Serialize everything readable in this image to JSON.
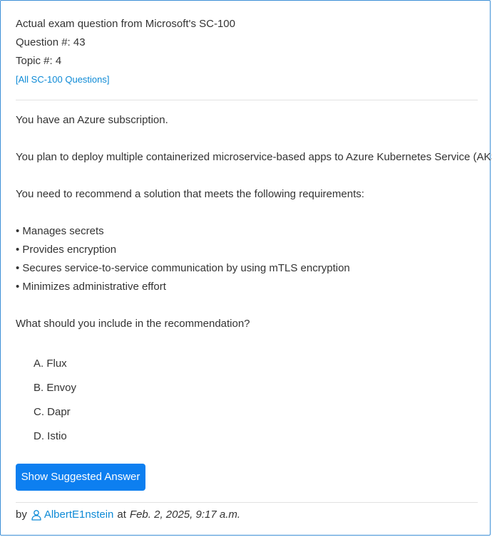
{
  "header": {
    "title": "Actual exam question from Microsoft's SC-100",
    "question_number": "Question #: 43",
    "topic_number": "Topic #: 4",
    "all_questions_link": "[All SC-100 Questions]"
  },
  "question": {
    "line1": "You have an Azure subscription.",
    "line2": "You plan to deploy multiple containerized microservice-based apps to Azure Kubernetes Service (AKS).",
    "line3": "You need to recommend a solution that meets the following requirements:",
    "requirements": [
      "• Manages secrets",
      "• Provides encryption",
      "• Secures service-to-service communication by using mTLS encryption",
      "• Minimizes administrative effort"
    ],
    "prompt": "What should you include in the recommendation?"
  },
  "options": [
    "A. Flux",
    "B. Envoy",
    "C. Dapr",
    "D. Istio"
  ],
  "button": {
    "label": "Show Suggested Answer"
  },
  "footer": {
    "by": "by",
    "user": "AlbertE1nstein",
    "at": "at",
    "date": "Feb. 2, 2025, 9:17 a.m."
  },
  "colors": {
    "accent": "#0d7ff0",
    "link": "#0d8ad6",
    "border": "#3d8fd6"
  },
  "icons": {
    "user": "user-outline-icon"
  }
}
